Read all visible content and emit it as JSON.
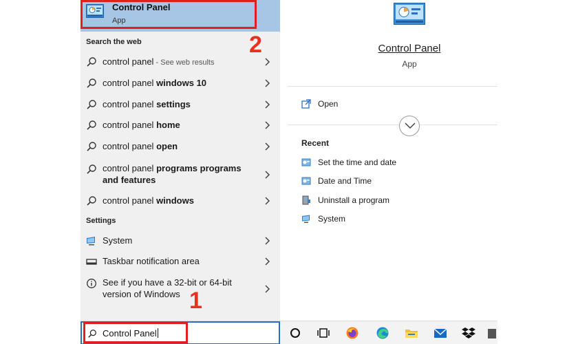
{
  "best_match": {
    "title": "Control Panel",
    "subtitle": "App"
  },
  "web_section": {
    "heading": "Search the web",
    "items": [
      {
        "prefix": "control panel",
        "bold": "",
        "suffix": " - See web results"
      },
      {
        "prefix": "control panel ",
        "bold": "windows 10",
        "suffix": ""
      },
      {
        "prefix": "control panel ",
        "bold": "settings",
        "suffix": ""
      },
      {
        "prefix": "control panel ",
        "bold": "home",
        "suffix": ""
      },
      {
        "prefix": "control panel ",
        "bold": "open",
        "suffix": ""
      },
      {
        "prefix": "control panel ",
        "bold": "programs programs and features",
        "suffix": ""
      },
      {
        "prefix": "control panel ",
        "bold": "windows",
        "suffix": ""
      }
    ]
  },
  "settings_section": {
    "heading": "Settings",
    "items": [
      {
        "label": "System",
        "icon": "monitor-icon"
      },
      {
        "label": "Taskbar notification area",
        "icon": "taskbar-icon"
      },
      {
        "label": "See if you have a 32-bit or 64-bit version of Windows",
        "icon": "info-icon"
      }
    ]
  },
  "preview": {
    "title": "Control Panel",
    "subtitle": "App",
    "open_label": "Open",
    "recent_heading": "Recent",
    "recent_items": [
      "Set the time and date",
      "Date and Time",
      "Uninstall a program",
      "System"
    ]
  },
  "search": {
    "value": "Control Panel"
  },
  "annotations": {
    "step1": "1",
    "step2": "2"
  },
  "colors": {
    "selected_bg": "#a7c6e5",
    "pane_bg": "#f0f0f0",
    "annotation_red": "#e02020",
    "search_border": "#2b6cc4"
  },
  "taskbar_icons": [
    "cortana-icon",
    "task-view-icon",
    "firefox-icon",
    "edge-icon",
    "file-explorer-icon",
    "mail-icon",
    "dropbox-icon",
    "more-icon"
  ]
}
